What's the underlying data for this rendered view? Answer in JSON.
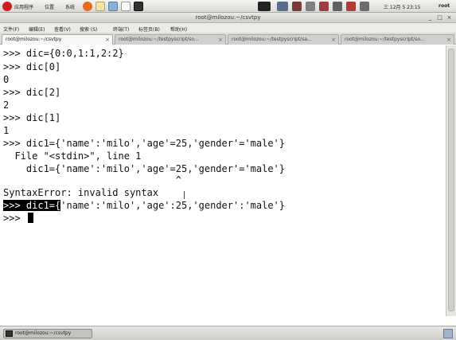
{
  "top_panel": {
    "menus": [
      "应用程序",
      "位置",
      "系统"
    ],
    "clock": "三 12月  5 23:15",
    "user": "root",
    "colors": {
      "panel_bg": "#e4e4e0",
      "redhat": "#cc1e1e",
      "firefox": "#e86a1c"
    }
  },
  "window": {
    "title": "root@milozou:~/csvtpy",
    "menus": [
      "文件(F)",
      "编辑(E)",
      "查看(V)",
      "搜索 (S)",
      "终端(T)",
      "标签页(B)",
      "帮助(H)"
    ],
    "tabs": [
      {
        "label": "root@milozou:~/csvtpy",
        "active": true
      },
      {
        "label": "root@milozou:~/testpyscript/so...",
        "active": false
      },
      {
        "label": "root@milozou:~/testpyscript/sa...",
        "active": false
      },
      {
        "label": "root@milozou:~/testpyscript/so...",
        "active": false
      }
    ]
  },
  "terminal": {
    "lines": [
      ">>> dic={0:0,1:1,2:2}",
      ">>> dic[0]",
      "0",
      ">>> dic[2]",
      "2",
      ">>> dic[1]",
      "1",
      ">>> dic1={'name':'milo','age'=25,'gender'='male'}",
      "  File \"<stdin>\", line 1",
      "    dic1={'name':'milo','age'=25,'gender'='male'}",
      "                              ^",
      "SyntaxError: invalid syntax",
      "",
      ">>> "
    ],
    "highlighted_prefix": ">>> dic1={",
    "highlighted_rest": "'name':'milo','age':25,'gender':'male'}",
    "colors": {
      "bg": "#ffffff",
      "fg": "#111111",
      "selection_bg": "#000000"
    }
  },
  "taskbar": {
    "task_label": "root@milozou:~/csvtpy"
  }
}
